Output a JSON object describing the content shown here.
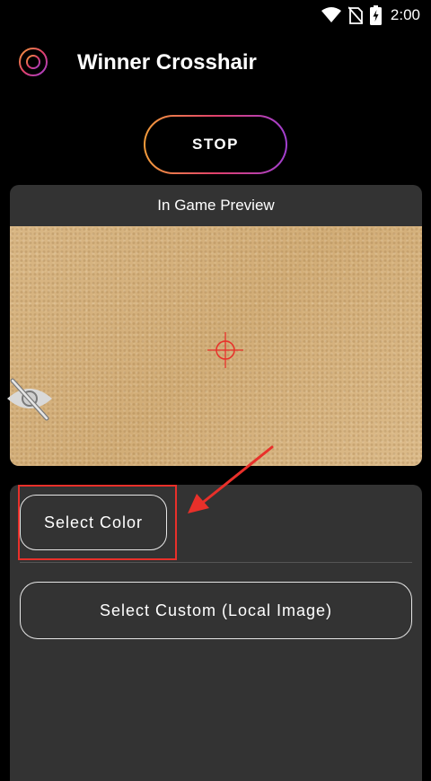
{
  "status_bar": {
    "time": "2:00",
    "icons": [
      "wifi-icon",
      "no-sim-icon",
      "battery-charging-icon"
    ]
  },
  "header": {
    "title": "Winner Crosshair",
    "logo_icon": "crosshair-logo-icon"
  },
  "controls": {
    "stop_label": "STOP"
  },
  "preview": {
    "title": "In Game Preview",
    "crosshair_icon": "crosshair-icon",
    "hide_icon": "eye-off-icon"
  },
  "options": {
    "select_color_label": "Select Color",
    "select_custom_label": "Select Custom (Local Image)"
  },
  "colors": {
    "background": "#000000",
    "card": "#333333",
    "crosshair": "#e8302a",
    "annotation": "#e8302a",
    "gradient_start": "#f29c3a",
    "gradient_end": "#a13fd1"
  }
}
